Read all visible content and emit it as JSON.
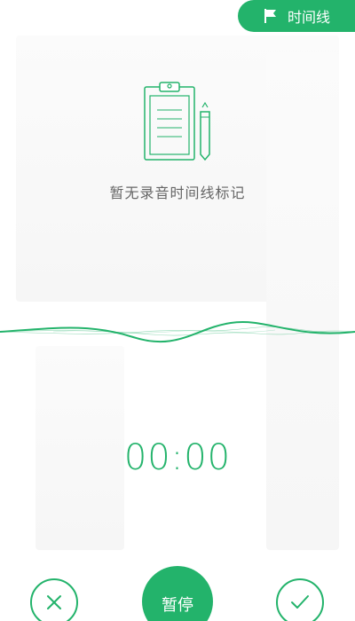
{
  "header": {
    "timeline_label": "时间线"
  },
  "empty_state": {
    "message": "暂无录音时间线标记",
    "icon": "clipboard-icon"
  },
  "recorder": {
    "elapsed": "00:00"
  },
  "controls": {
    "pause_label": "暂停",
    "cancel_icon": "close-icon",
    "confirm_icon": "check-icon"
  },
  "colors": {
    "accent": "#23b36b",
    "text_muted": "#666666"
  }
}
